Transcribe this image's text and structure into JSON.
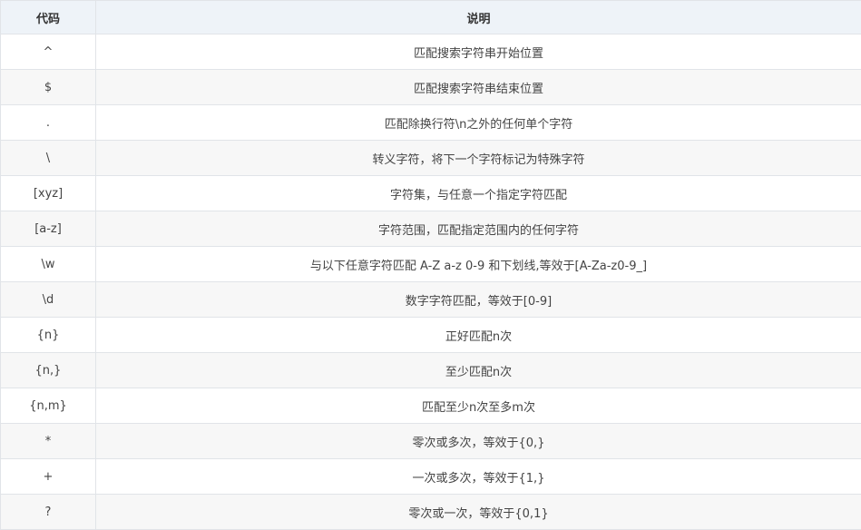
{
  "table": {
    "headers": [
      "代码",
      "说明"
    ],
    "rows": [
      [
        "^",
        "匹配搜索字符串开始位置"
      ],
      [
        "$",
        "匹配搜索字符串结束位置"
      ],
      [
        ".",
        "匹配除换行符\\n之外的任何单个字符"
      ],
      [
        "\\",
        "转义字符，将下一个字符标记为特殊字符"
      ],
      [
        "[xyz]",
        "字符集，与任意一个指定字符匹配"
      ],
      [
        "[a-z]",
        "字符范围，匹配指定范围内的任何字符"
      ],
      [
        "\\w",
        "与以下任意字符匹配 A-Z a-z 0-9 和下划线,等效于[A-Za-z0-9_]"
      ],
      [
        "\\d",
        "数字字符匹配，等效于[0-9]"
      ],
      [
        "{n}",
        "正好匹配n次"
      ],
      [
        "{n,}",
        "至少匹配n次"
      ],
      [
        "{n,m}",
        "匹配至少n次至多m次"
      ],
      [
        "*",
        "零次或多次，等效于{0,}"
      ],
      [
        "+",
        "一次或多次，等效于{1,}"
      ],
      [
        "?",
        "零次或一次，等效于{0,1}"
      ]
    ]
  }
}
